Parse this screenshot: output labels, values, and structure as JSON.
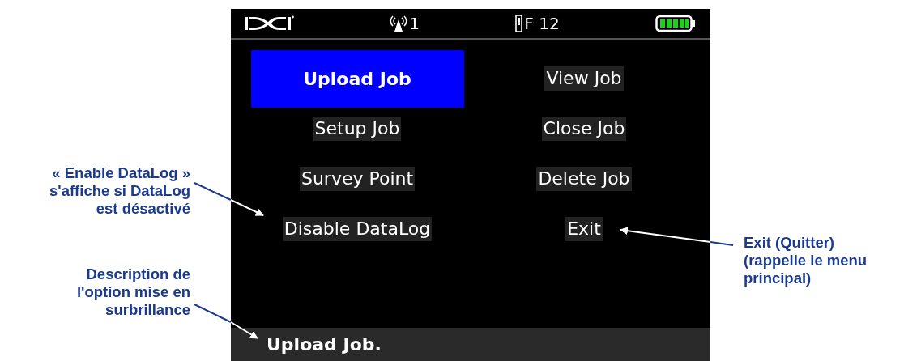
{
  "status_bar": {
    "signal_reading": "1",
    "frequency_reading": "F 12"
  },
  "menu": {
    "items": [
      {
        "label": "Upload Job",
        "selected": true
      },
      {
        "label": "View Job",
        "selected": false
      },
      {
        "label": "Setup Job",
        "selected": false
      },
      {
        "label": "Close Job",
        "selected": false
      },
      {
        "label": "Survey Point",
        "selected": false
      },
      {
        "label": "Delete Job",
        "selected": false
      },
      {
        "label": "Disable DataLog",
        "selected": false
      },
      {
        "label": "Exit",
        "selected": false
      }
    ]
  },
  "description": "Upload Job.",
  "left_callouts": [
    "« Enable DataLog »\ns'affiche si DataLog\nest désactivé",
    "Description de\nl'option mise en\nsurbrillance"
  ],
  "right_callouts": [
    "Exit (Quitter)\n(rappelle le menu\nprincipal)"
  ]
}
